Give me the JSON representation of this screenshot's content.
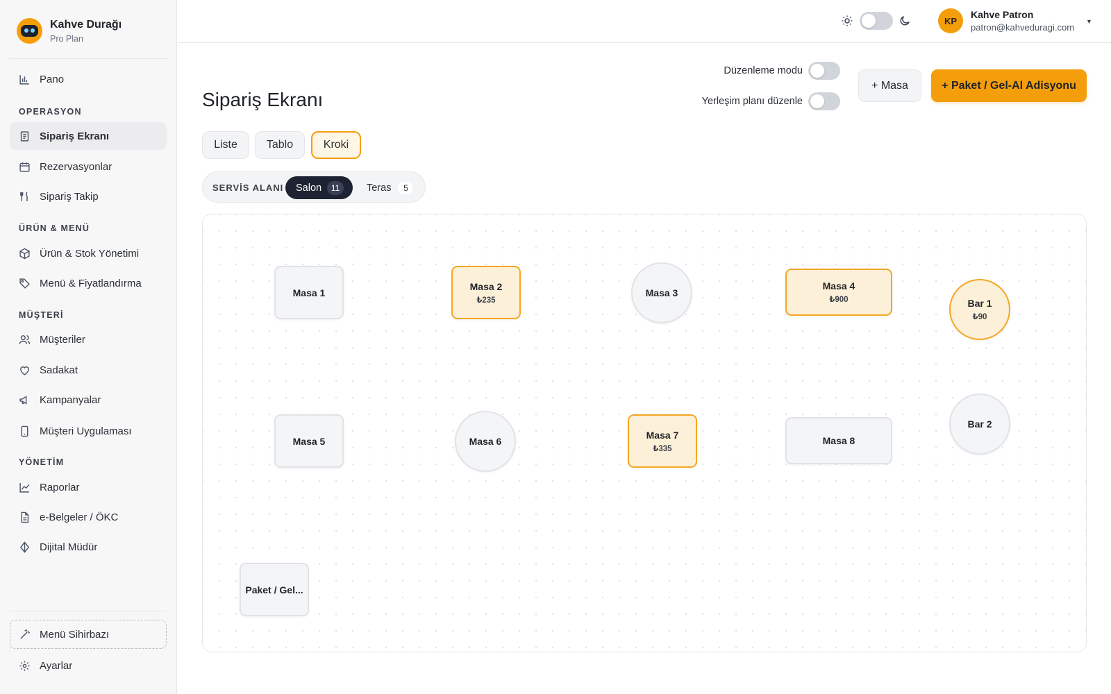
{
  "brand": {
    "name": "Kahve Durağı",
    "plan": "Pro Plan"
  },
  "sidebar": {
    "top_item": {
      "label": "Pano",
      "icon": "bar-chart-icon"
    },
    "sections": [
      {
        "title": "OPERASYON",
        "items": [
          {
            "label": "Sipariş Ekranı",
            "icon": "receipt-icon",
            "active": true
          },
          {
            "label": "Rezervasyonlar",
            "icon": "calendar-icon"
          },
          {
            "label": "Sipariş Takip",
            "icon": "fork-knife-icon"
          }
        ]
      },
      {
        "title": "ÜRÜN & MENÜ",
        "items": [
          {
            "label": "Ürün & Stok Yönetimi",
            "icon": "box-icon"
          },
          {
            "label": "Menü & Fiyatlandırma",
            "icon": "tag-icon"
          }
        ]
      },
      {
        "title": "MÜŞTERİ",
        "items": [
          {
            "label": "Müşteriler",
            "icon": "users-icon"
          },
          {
            "label": "Sadakat",
            "icon": "heart-icon"
          },
          {
            "label": "Kampanyalar",
            "icon": "megaphone-icon"
          },
          {
            "label": "Müşteri Uygulaması",
            "icon": "phone-icon"
          }
        ]
      },
      {
        "title": "YÖNETİM",
        "items": [
          {
            "label": "Raporlar",
            "icon": "line-chart-icon"
          },
          {
            "label": "e-Belgeler / ÖKC",
            "icon": "document-icon"
          },
          {
            "label": "Dijital Müdür",
            "icon": "diamond-icon"
          }
        ]
      }
    ],
    "wizard": {
      "label": "Menü Sihirbazı",
      "icon": "magic-wand-icon"
    },
    "settings": {
      "label": "Ayarlar",
      "icon": "gear-icon"
    }
  },
  "topbar": {
    "theme": "light",
    "user": {
      "initials": "KP",
      "name": "Kahve Patron",
      "email": "patron@kahveduragi.com"
    }
  },
  "page": {
    "title": "Sipariş Ekranı",
    "edit_mode_label": "Düzenleme modu",
    "edit_mode_on": false,
    "layout_edit_label": "Yerleşim planı düzenle",
    "layout_edit_on": false,
    "add_table_label": "+ Masa",
    "takeaway_label": "+ Paket / Gel-Al Adisyonu"
  },
  "views": {
    "liste": "Liste",
    "tablo": "Tablo",
    "kroki": "Kroki",
    "active": "Kroki"
  },
  "service_area": {
    "label": "SERVİS ALANI",
    "salon": {
      "label": "Salon",
      "count": "11",
      "active": true
    },
    "teras": {
      "label": "Teras",
      "count": "5"
    }
  },
  "tables": {
    "masa1": {
      "name": "Masa 1",
      "amount": ""
    },
    "masa2": {
      "name": "Masa 2",
      "amount": "₺235"
    },
    "masa3": {
      "name": "Masa 3",
      "amount": ""
    },
    "masa4": {
      "name": "Masa 4",
      "amount": "₺900"
    },
    "bar1": {
      "name": "Bar 1",
      "amount": "₺90"
    },
    "masa5": {
      "name": "Masa 5",
      "amount": ""
    },
    "masa6": {
      "name": "Masa 6",
      "amount": ""
    },
    "masa7": {
      "name": "Masa 7",
      "amount": "₺335"
    },
    "masa8": {
      "name": "Masa 8",
      "amount": ""
    },
    "bar2": {
      "name": "Bar 2",
      "amount": ""
    },
    "paket": {
      "name": "Paket / Gel...",
      "amount": ""
    }
  },
  "colors": {
    "accent": "#f59e0b",
    "occupied_bg": "#fdf0d8",
    "dark_pill": "#1e2333"
  }
}
